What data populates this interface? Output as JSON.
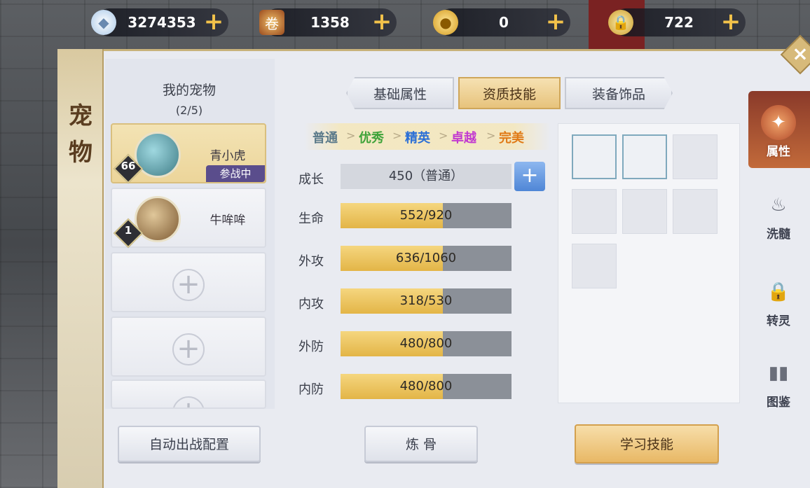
{
  "currencies": [
    {
      "icon": "diamond-icon",
      "value": "3274353",
      "plus": "+"
    },
    {
      "icon": "scroll-token-icon",
      "value": "1358",
      "plus": "+"
    },
    {
      "icon": "gold-ingot-icon",
      "value": "0",
      "plus": "+"
    },
    {
      "icon": "locked-ingot-icon",
      "value": "722",
      "plus": "+"
    }
  ],
  "window": {
    "title_line1": "宠",
    "title_line2": "物",
    "close": "×"
  },
  "pet_list": {
    "title": "我的宠物",
    "count": "(2/5)",
    "pets": [
      {
        "level": "66",
        "name": "青小虎",
        "status": "参战中"
      },
      {
        "level": "1",
        "name": "牛哞哞"
      }
    ],
    "empty_slot_symbol": "+",
    "auto_config_label": "自动出战配置"
  },
  "tabs": [
    {
      "label": "基础属性"
    },
    {
      "label": "资质技能"
    },
    {
      "label": "装备饰品"
    }
  ],
  "quality_tiers": [
    {
      "label": "普通",
      "color": "#5b7a8a"
    },
    {
      "label": "优秀",
      "color": "#3fa33a"
    },
    {
      "label": "精英",
      "color": "#2b6fd6"
    },
    {
      "label": "卓越",
      "color": "#c23ad0"
    },
    {
      "label": "完美",
      "color": "#e07a16"
    }
  ],
  "quality_separator": ">",
  "growth": {
    "label": "成长",
    "value": "450（普通）",
    "plus": "+"
  },
  "stats": [
    {
      "label": "生命",
      "text": "552/920",
      "fraction": 0.6
    },
    {
      "label": "外攻",
      "text": "636/1060",
      "fraction": 0.6
    },
    {
      "label": "内攻",
      "text": "318/530",
      "fraction": 0.6
    },
    {
      "label": "外防",
      "text": "480/800",
      "fraction": 0.6
    },
    {
      "label": "内防",
      "text": "480/800",
      "fraction": 0.6
    }
  ],
  "actions": {
    "refine_bone": "炼 骨",
    "learn_skill": "学习技能"
  },
  "side_nav": [
    {
      "icon": "fox-mask-icon",
      "label": "属性"
    },
    {
      "icon": "cauldron-icon",
      "label": "洗髓"
    },
    {
      "icon": "lock-icon",
      "label": "转灵"
    },
    {
      "icon": "book-icon",
      "label": "图鉴"
    }
  ]
}
